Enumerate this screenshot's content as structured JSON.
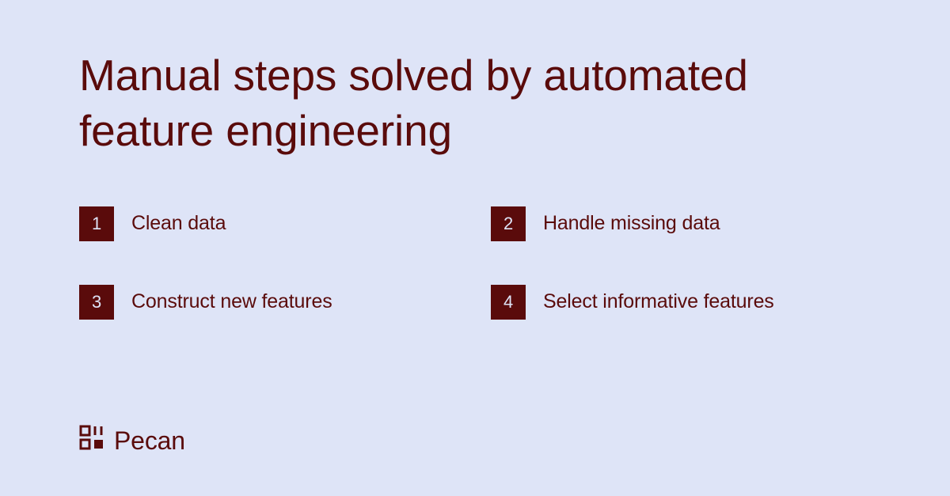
{
  "title": "Manual steps solved by automated feature engineering",
  "steps": [
    {
      "n": "1",
      "label": "Clean data"
    },
    {
      "n": "2",
      "label": "Handle missing data"
    },
    {
      "n": "3",
      "label": "Construct new features"
    },
    {
      "n": "4",
      "label": "Select informative features"
    }
  ],
  "brand": {
    "name": "Pecan"
  },
  "colors": {
    "bg": "#dee4f7",
    "fg": "#5a0b0b"
  }
}
